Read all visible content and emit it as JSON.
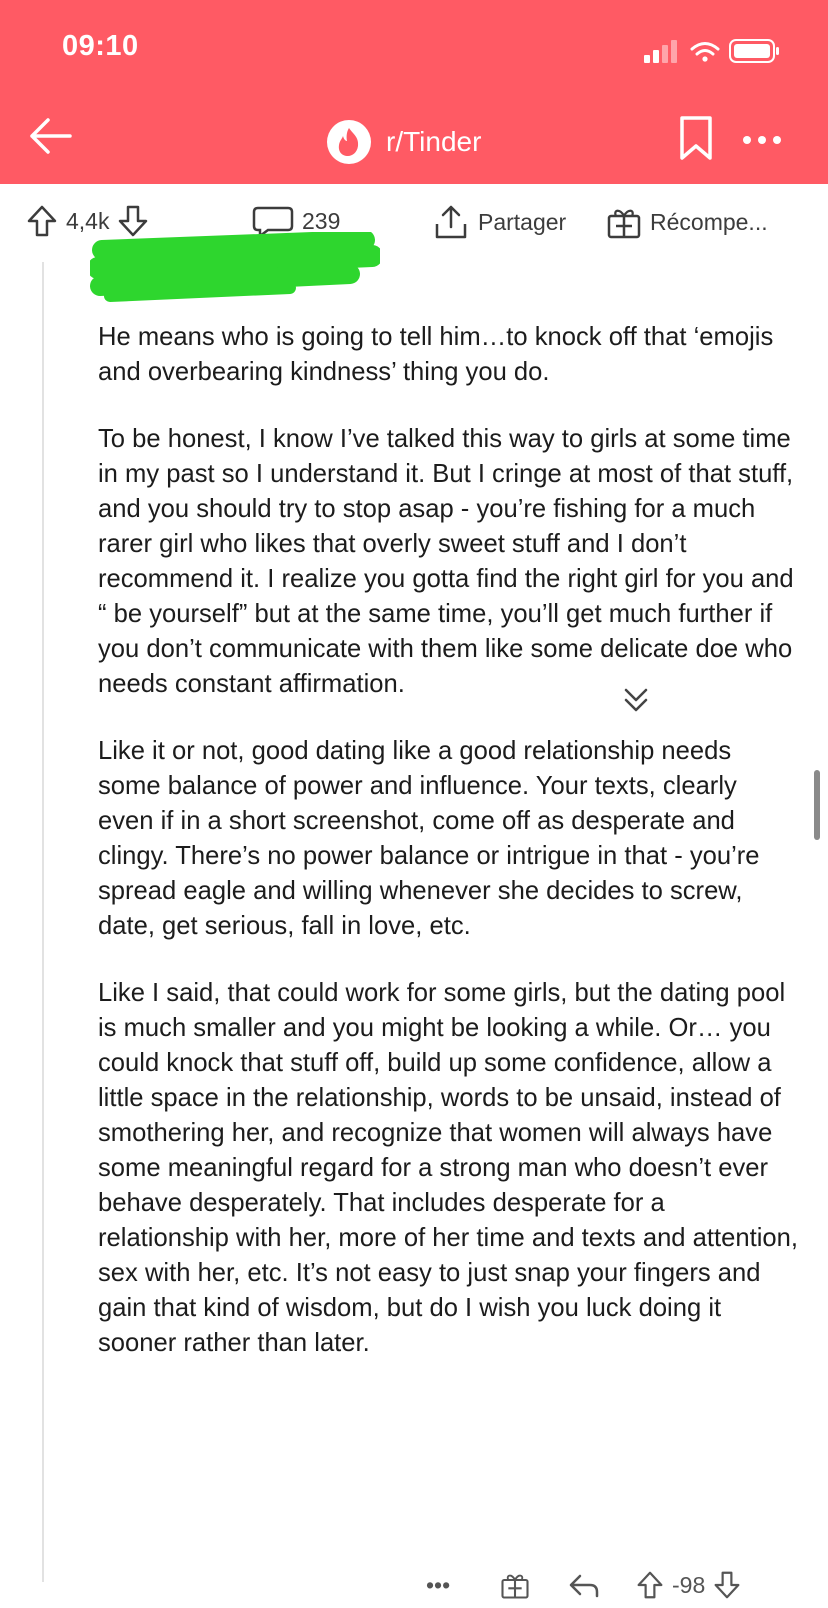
{
  "status_bar": {
    "time": "09:10"
  },
  "header": {
    "subreddit": "r/Tinder",
    "theme_color": "#ff5a64"
  },
  "post_actions": {
    "upvotes": "4,4k",
    "comments": "239",
    "share_label": "Partager",
    "award_label": "Récompe..."
  },
  "comment": {
    "paragraphs": [
      "He means who is going to tell him…to knock off that ‘emojis and overbearing kindness’ thing you do.",
      "To be honest, I know I’ve talked this way to girls at some time in my past so I understand it. But I cringe at most of that stuff, and you should try to stop asap - you’re fishing for a much rarer girl who likes that overly sweet stuff and I don’t recommend it. I realize you gotta find the right girl for you and “ be yourself” but at the same time, you’ll get much further if you don’t communicate with them like some delicate doe who needs constant affirmation.",
      "Like it or not, good dating like a good relationship needs some balance of power and influence. Your texts, clearly even if in a short screenshot, come off as desperate and clingy. There’s no power balance or intrigue in that - you’re spread eagle and willing whenever she decides to screw, date, get serious, fall in love, etc.",
      "Like I said, that could work for some girls, but the dating pool is much smaller and you might be looking a while. Or… you could knock that stuff off, build up some confidence, allow a little space in the relationship, words to be unsaid, instead of smothering her, and recognize that women will always have some meaningful regard for a strong man who doesn’t ever behave desperately. That includes desperate for a relationship with her, more of her time and texts and attention, sex with her, etc. It’s not easy to just snap your fingers and gain that kind of wisdom, but do I wish you luck doing it sooner rather than later."
    ]
  },
  "comment_actions": {
    "more": "•••",
    "score": "-98"
  },
  "icons": {
    "back": "back-arrow-icon",
    "subreddit": "tinder-flame-icon",
    "bookmark": "bookmark-icon",
    "more": "more-icon",
    "upvote": "upvote-icon",
    "downvote": "downvote-icon",
    "comments": "comment-bubble-icon",
    "share": "share-icon",
    "award": "award-gift-icon",
    "reply": "reply-icon"
  }
}
